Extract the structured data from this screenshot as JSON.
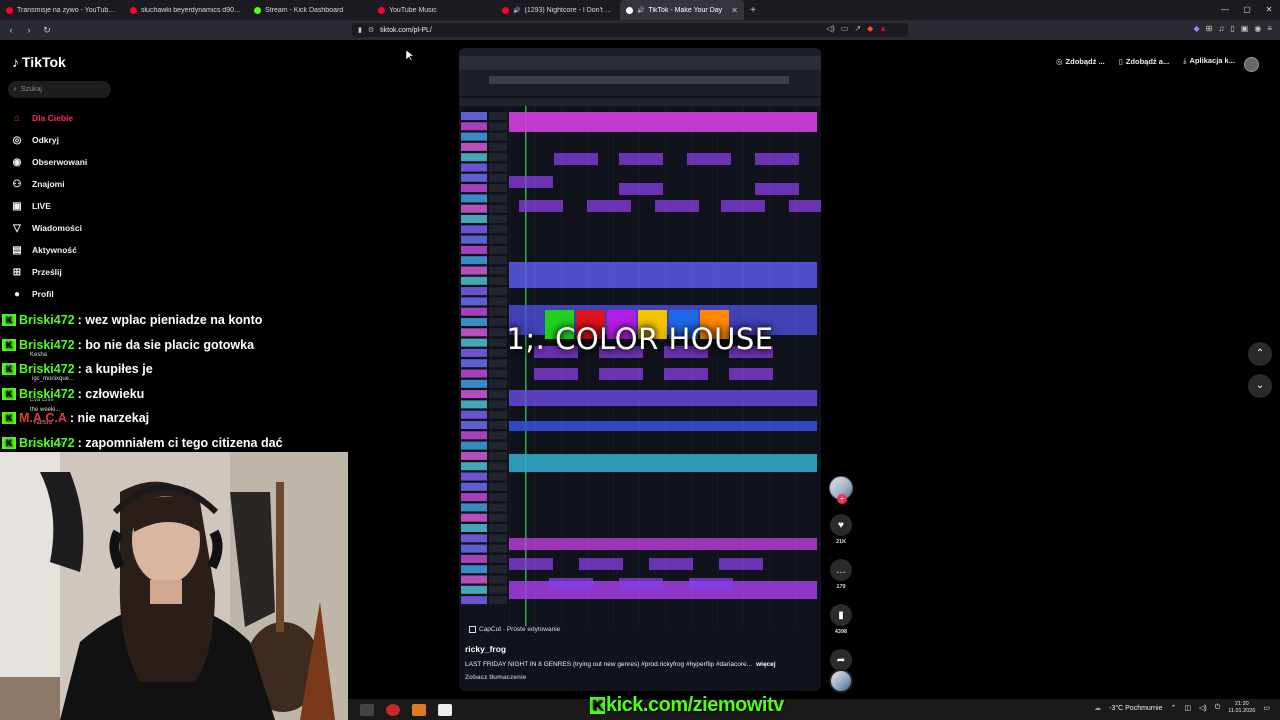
{
  "browser": {
    "tabs": [
      {
        "label": "Transmisje na żywo - YouTube Studio",
        "color": "#ff0033"
      },
      {
        "label": "słuchawki beyerdynamics d900 - Szu",
        "color": "#ff0033"
      },
      {
        "label": "Stream - Kick Dashboard",
        "color": "#53fc18"
      },
      {
        "label": "YouTube Music",
        "color": "#ff0033"
      },
      {
        "label": "(1293) Nightcore - I Don't Know",
        "color": "#ff0033",
        "audio": "🔊"
      },
      {
        "label": "TikTok - Make Your Day",
        "color": "#ffffff",
        "audio": "🔊",
        "active": true
      }
    ],
    "new_tab": "+",
    "url": "tiktok.com/pl-PL/",
    "window_controls": [
      "—",
      "▢",
      "✕"
    ]
  },
  "tiktok": {
    "logo": "TikTok",
    "search_placeholder": "Szukaj",
    "nav": [
      {
        "label": "Dla Ciebie",
        "icon": "home-icon",
        "glyph": "⌂",
        "active": true
      },
      {
        "label": "Odkryj",
        "icon": "compass-icon",
        "glyph": "◎"
      },
      {
        "label": "Obserwowani",
        "icon": "following-icon",
        "glyph": "◉"
      },
      {
        "label": "Znajomi",
        "icon": "friends-icon",
        "glyph": "⚇"
      },
      {
        "label": "LIVE",
        "icon": "live-icon",
        "glyph": "▣"
      },
      {
        "label": "Wiadomości",
        "icon": "messages-icon",
        "glyph": "▽"
      },
      {
        "label": "Aktywność",
        "icon": "activity-icon",
        "glyph": "▤"
      },
      {
        "label": "Prześlij",
        "icon": "upload-icon",
        "glyph": "⊞"
      },
      {
        "label": "Profil",
        "icon": "profile-icon",
        "glyph": "●"
      }
    ],
    "header": {
      "coins": "Zdobądź ...",
      "pc_app": "Zdobądź a...",
      "app": "Aplikacja k..."
    },
    "video": {
      "title": "1;. COLOR HOUSE",
      "capcut": "CapCut · Proste edytowanie",
      "author": "ricky_frog",
      "caption": "LAST FRIDAY NIGHT IN 8 GENRES (trying out new genres) #prod.rickyfrog #hyperflip #dariacore...",
      "more": "więcej",
      "translate": "Zobacz tłumaczenie",
      "swatch_colors": [
        "#1fd21f",
        "#e0141c",
        "#b51ee6",
        "#f5c400",
        "#1e6be8",
        "#ff8a00"
      ]
    },
    "actions": {
      "likes": "21K",
      "comments": "179",
      "saves": "4398",
      "shares": "801"
    }
  },
  "chat": [
    {
      "user": "Briski472",
      "text": ": wez wplac pieniadze na konto"
    },
    {
      "user": "Briski472",
      "text": ": bo nie da sie placic gotowka"
    },
    {
      "user": "Briski472",
      "text": ": a kupiłes je"
    },
    {
      "user": "Briski472",
      "text": ": człowieku"
    },
    {
      "user": "M.A.C.A",
      "text": ": nie narzekaj"
    },
    {
      "user": "Briski472",
      "text": ": zapomniałem ci tego citizena dać"
    }
  ],
  "overlay_ghost_names": [
    "Kesha",
    "igc_monixque...",
    "Eva Elfie",
    "the weeki...",
    "Aurora",
    "wiktoria5300"
  ],
  "stream": {
    "kick_url": "kick.com/ziemowitv"
  },
  "tray": {
    "weather": "-3°C  Pochmurnie",
    "time": "21:20",
    "date": "11.01.2026"
  },
  "colors": {
    "kick_green": "#53fc18",
    "tiktok_red": "#fe2c55"
  }
}
